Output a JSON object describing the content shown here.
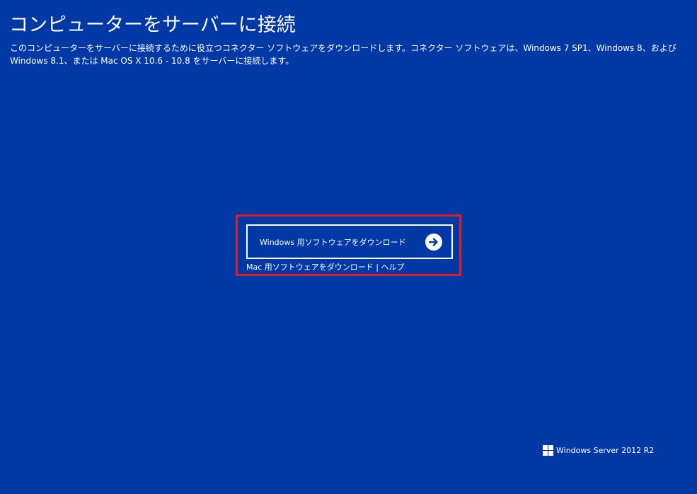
{
  "page": {
    "title": "コンピューターをサーバーに接続",
    "intro_line1": "このコンピューターをサーバーに接続するために役立つコネクター ソフトウェアをダウンロードします。コネクター ソフトウェアは、Windows 7 SP1、Windows 8、および",
    "intro_line2": "Windows 8.1、または Mac OS X 10.6 - 10.8 をサーバーに接続します。"
  },
  "download": {
    "windows_label": "Windows 用ソフトウェアをダウンロード",
    "arrow_icon": "arrow-right-circle-icon",
    "mac_link": "Mac 用ソフトウェアをダウンロード",
    "separator": " | ",
    "help_link": "ヘルプ"
  },
  "branding": {
    "logo_icon": "windows-logo-icon",
    "product_name": "Windows Server 2012 R2"
  },
  "colors": {
    "background": "#0039A6",
    "highlight_border": "#E01E26",
    "text": "#FFFFFF"
  }
}
